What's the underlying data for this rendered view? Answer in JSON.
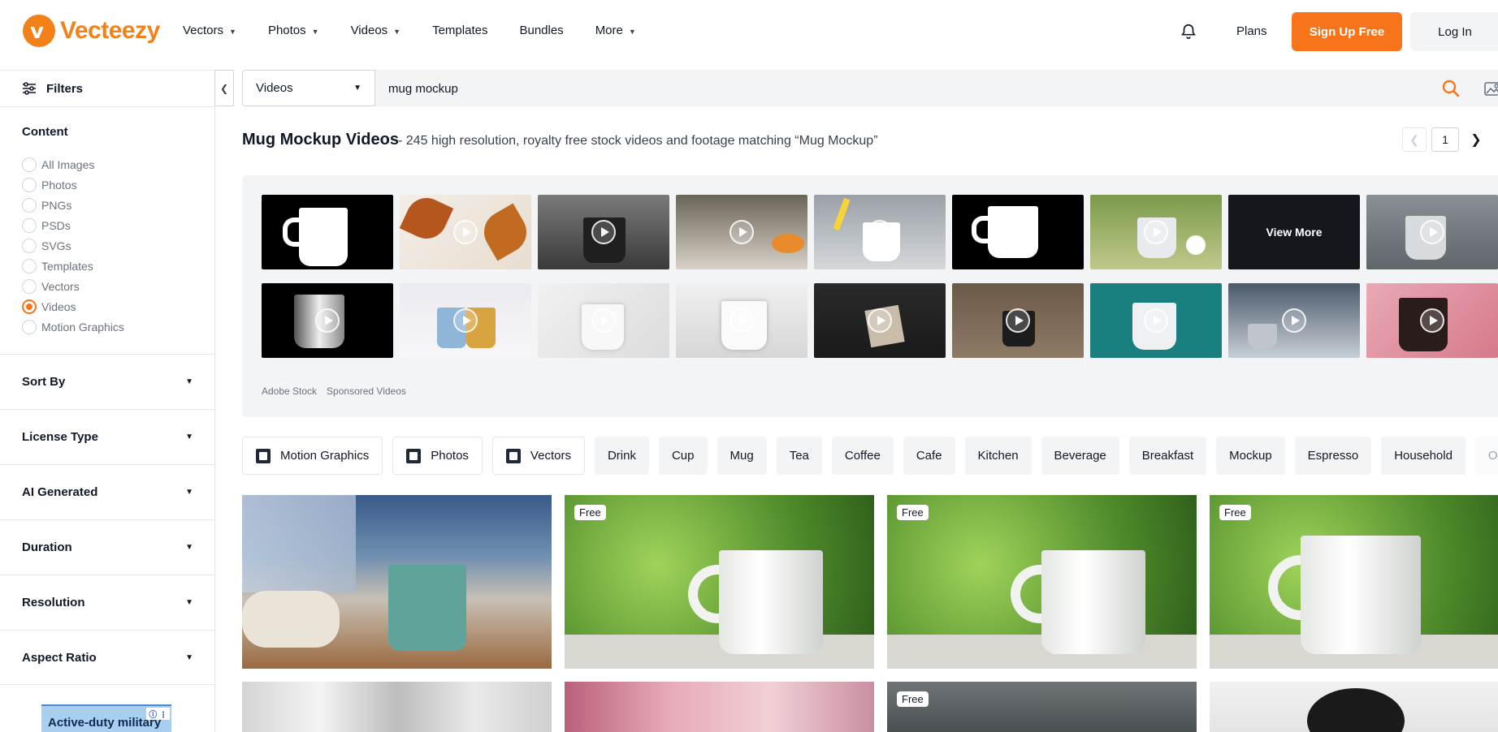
{
  "header": {
    "logo_text": "Vecteezy",
    "nav": [
      {
        "label": "Vectors",
        "has_menu": true
      },
      {
        "label": "Photos",
        "has_menu": true
      },
      {
        "label": "Videos",
        "has_menu": true
      },
      {
        "label": "Templates",
        "has_menu": false
      },
      {
        "label": "Bundles",
        "has_menu": false
      },
      {
        "label": "More",
        "has_menu": true
      }
    ],
    "plans": "Plans",
    "signup": "Sign Up Free",
    "login": "Log In",
    "brand_color": "#f8741a"
  },
  "sidebar": {
    "filters_label": "Filters",
    "content_title": "Content",
    "content_options": [
      {
        "label": "All Images",
        "checked": false
      },
      {
        "label": "Photos",
        "checked": false
      },
      {
        "label": "PNGs",
        "checked": false
      },
      {
        "label": "PSDs",
        "checked": false
      },
      {
        "label": "SVGs",
        "checked": false
      },
      {
        "label": "Templates",
        "checked": false
      },
      {
        "label": "Vectors",
        "checked": false
      },
      {
        "label": "Videos",
        "checked": true
      },
      {
        "label": "Motion Graphics",
        "checked": false
      }
    ],
    "sections": [
      "Sort By",
      "License Type",
      "AI Generated",
      "Duration",
      "Resolution",
      "Aspect Ratio"
    ],
    "ad_text": "Active-duty military"
  },
  "search": {
    "category": "Videos",
    "query": "mug mockup"
  },
  "results_header": {
    "title": "Mug Mockup Videos",
    "subtitle": "- 245 high resolution, royalty free stock videos and footage matching “Mug Mockup”",
    "page": "1"
  },
  "sponsored": {
    "view_more": "View More",
    "source": "Adobe Stock",
    "label": "Sponsored Videos"
  },
  "chips": [
    {
      "label": "Motion Graphics",
      "style": "outline",
      "icon": "motion-graphics-icon"
    },
    {
      "label": "Photos",
      "style": "outline",
      "icon": "photo-icon"
    },
    {
      "label": "Vectors",
      "style": "outline",
      "icon": "vector-icon"
    },
    {
      "label": "Drink",
      "style": "fill"
    },
    {
      "label": "Cup",
      "style": "fill"
    },
    {
      "label": "Mug",
      "style": "fill"
    },
    {
      "label": "Tea",
      "style": "fill"
    },
    {
      "label": "Coffee",
      "style": "fill"
    },
    {
      "label": "Cafe",
      "style": "fill"
    },
    {
      "label": "Kitchen",
      "style": "fill"
    },
    {
      "label": "Beverage",
      "style": "fill"
    },
    {
      "label": "Breakfast",
      "style": "fill"
    },
    {
      "label": "Mockup",
      "style": "fill"
    },
    {
      "label": "Espresso",
      "style": "fill"
    },
    {
      "label": "Household",
      "style": "fill"
    },
    {
      "label": "Object",
      "style": "faded"
    }
  ],
  "results": [
    {
      "free": ""
    },
    {
      "free": "Free"
    },
    {
      "free": "Free"
    },
    {
      "free": "Free"
    },
    {
      "free": ""
    },
    {
      "free": ""
    },
    {
      "free": "Free"
    },
    {
      "free": ""
    }
  ]
}
